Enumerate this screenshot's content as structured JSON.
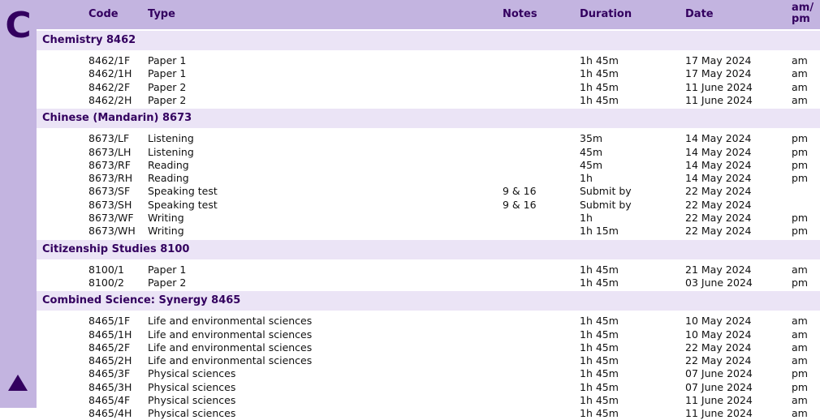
{
  "side_letter": "C",
  "columns": {
    "code": "Code",
    "type": "Type",
    "notes": "Notes",
    "duration": "Duration",
    "date": "Date",
    "ampm_line1": "am/",
    "ampm_line2": "pm"
  },
  "sections": [
    {
      "title": "Chemistry  8462",
      "rows": [
        {
          "code": "8462/1F",
          "type": "Paper 1",
          "notes": "",
          "duration": "1h 45m",
          "date": "17 May 2024",
          "ampm": "am"
        },
        {
          "code": "8462/1H",
          "type": "Paper 1",
          "notes": "",
          "duration": "1h 45m",
          "date": "17 May 2024",
          "ampm": "am"
        },
        {
          "code": "8462/2F",
          "type": "Paper 2",
          "notes": "",
          "duration": "1h 45m",
          "date": "11 June 2024",
          "ampm": "am"
        },
        {
          "code": "8462/2H",
          "type": "Paper 2",
          "notes": "",
          "duration": "1h 45m",
          "date": "11 June 2024",
          "ampm": "am"
        }
      ]
    },
    {
      "title": "Chinese (Mandarin)  8673",
      "rows": [
        {
          "code": "8673/LF",
          "type": "Listening",
          "notes": "",
          "duration": "35m",
          "date": "14 May 2024",
          "ampm": "pm"
        },
        {
          "code": "8673/LH",
          "type": "Listening",
          "notes": "",
          "duration": "45m",
          "date": "14 May 2024",
          "ampm": "pm"
        },
        {
          "code": "8673/RF",
          "type": "Reading",
          "notes": "",
          "duration": "45m",
          "date": "14 May 2024",
          "ampm": "pm"
        },
        {
          "code": "8673/RH",
          "type": "Reading",
          "notes": "",
          "duration": "1h",
          "date": "14 May 2024",
          "ampm": "pm"
        },
        {
          "code": "8673/SF",
          "type": "Speaking test",
          "notes": "9 & 16",
          "duration": "Submit by",
          "date": "22 May 2024",
          "ampm": ""
        },
        {
          "code": "8673/SH",
          "type": "Speaking test",
          "notes": "9 & 16",
          "duration": "Submit by",
          "date": "22 May 2024",
          "ampm": ""
        },
        {
          "code": "8673/WF",
          "type": "Writing",
          "notes": "",
          "duration": "1h",
          "date": "22 May 2024",
          "ampm": "pm"
        },
        {
          "code": "8673/WH",
          "type": "Writing",
          "notes": "",
          "duration": "1h 15m",
          "date": "22 May 2024",
          "ampm": "pm"
        }
      ]
    },
    {
      "title": "Citizenship Studies  8100",
      "rows": [
        {
          "code": "8100/1",
          "type": "Paper 1",
          "notes": "",
          "duration": "1h 45m",
          "date": "21 May 2024",
          "ampm": "am"
        },
        {
          "code": "8100/2",
          "type": "Paper 2",
          "notes": "",
          "duration": "1h 45m",
          "date": "03 June 2024",
          "ampm": "pm"
        }
      ]
    },
    {
      "title": "Combined Science: Synergy  8465",
      "rows": [
        {
          "code": "8465/1F",
          "type": "Life and environmental sciences",
          "notes": "",
          "duration": "1h 45m",
          "date": "10 May 2024",
          "ampm": "am"
        },
        {
          "code": "8465/1H",
          "type": "Life and environmental sciences",
          "notes": "",
          "duration": "1h 45m",
          "date": "10 May 2024",
          "ampm": "am"
        },
        {
          "code": "8465/2F",
          "type": "Life and environmental sciences",
          "notes": "",
          "duration": "1h 45m",
          "date": "22 May 2024",
          "ampm": "am"
        },
        {
          "code": "8465/2H",
          "type": "Life and environmental sciences",
          "notes": "",
          "duration": "1h 45m",
          "date": "22 May 2024",
          "ampm": "am"
        },
        {
          "code": "8465/3F",
          "type": "Physical sciences",
          "notes": "",
          "duration": "1h 45m",
          "date": "07 June 2024",
          "ampm": "pm"
        },
        {
          "code": "8465/3H",
          "type": "Physical sciences",
          "notes": "",
          "duration": "1h 45m",
          "date": "07 June 2024",
          "ampm": "pm"
        },
        {
          "code": "8465/4F",
          "type": "Physical sciences",
          "notes": "",
          "duration": "1h 45m",
          "date": "11 June 2024",
          "ampm": "am"
        },
        {
          "code": "8465/4H",
          "type": "Physical sciences",
          "notes": "",
          "duration": "1h 45m",
          "date": "11 June 2024",
          "ampm": "am"
        }
      ]
    }
  ]
}
